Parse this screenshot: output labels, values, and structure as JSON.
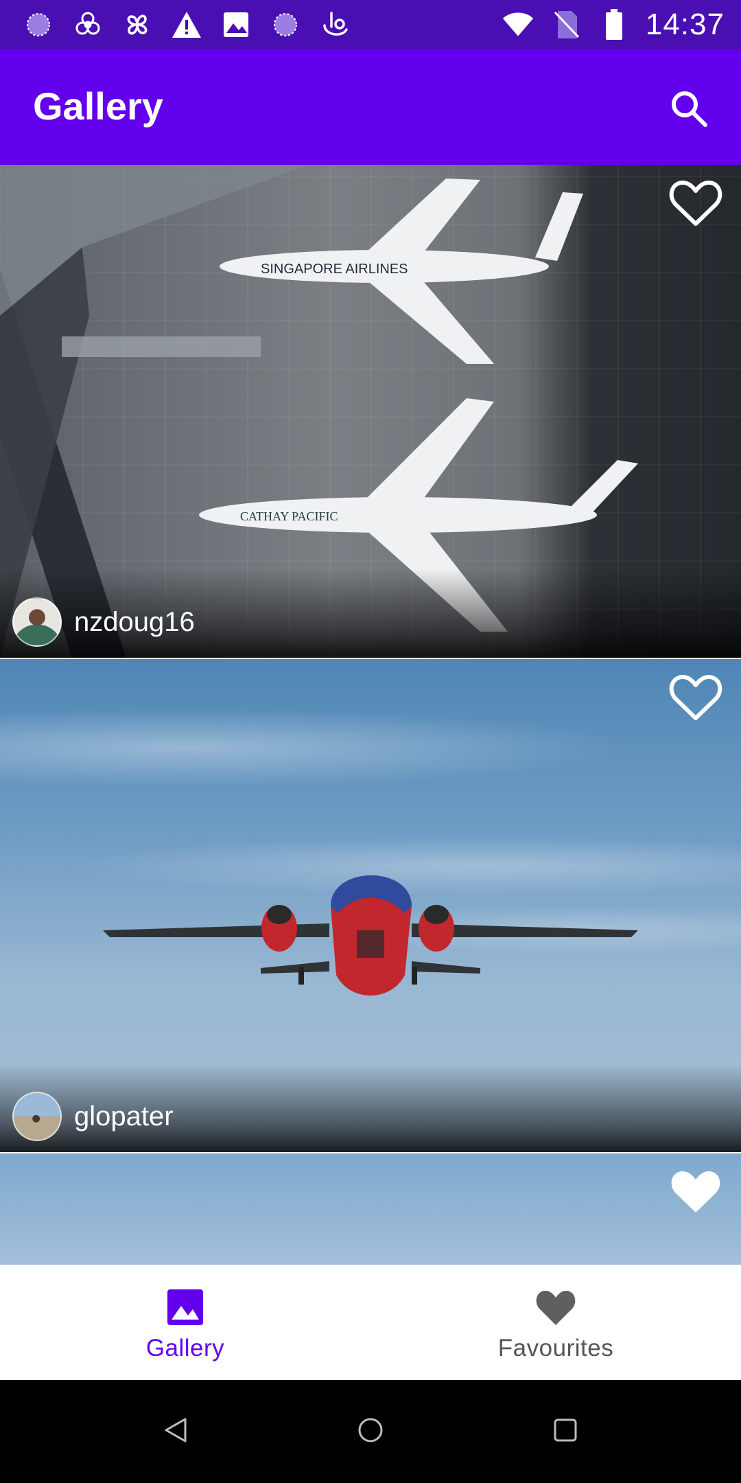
{
  "status_bar": {
    "time": "14:37",
    "left_icons": [
      "spinner-icon",
      "flower-icon",
      "fan-icon",
      "warning-icon",
      "image-icon",
      "spinner-icon",
      "touch-icon"
    ],
    "right_icons": [
      "wifi-icon",
      "no-sim-icon",
      "battery-icon"
    ]
  },
  "app_bar": {
    "title": "Gallery",
    "search_icon": "search-icon",
    "background": "#6200ee"
  },
  "feed": {
    "items": [
      {
        "author": "nzdoug16",
        "favourite": false,
        "photo": "airport-planes"
      },
      {
        "author": "glopater",
        "favourite": false,
        "photo": "plane-in-sky"
      },
      {
        "author": "",
        "favourite": true,
        "photo": "clouds-sky"
      }
    ]
  },
  "bottom_nav": {
    "items": [
      {
        "label": "Gallery",
        "icon": "image-icon",
        "active": true
      },
      {
        "label": "Favourites",
        "icon": "heart-icon",
        "active": false
      }
    ],
    "active_color": "#6200ee",
    "inactive_color": "#555555"
  },
  "system_nav": {
    "icons": [
      "back-icon",
      "home-icon",
      "recents-icon"
    ]
  }
}
